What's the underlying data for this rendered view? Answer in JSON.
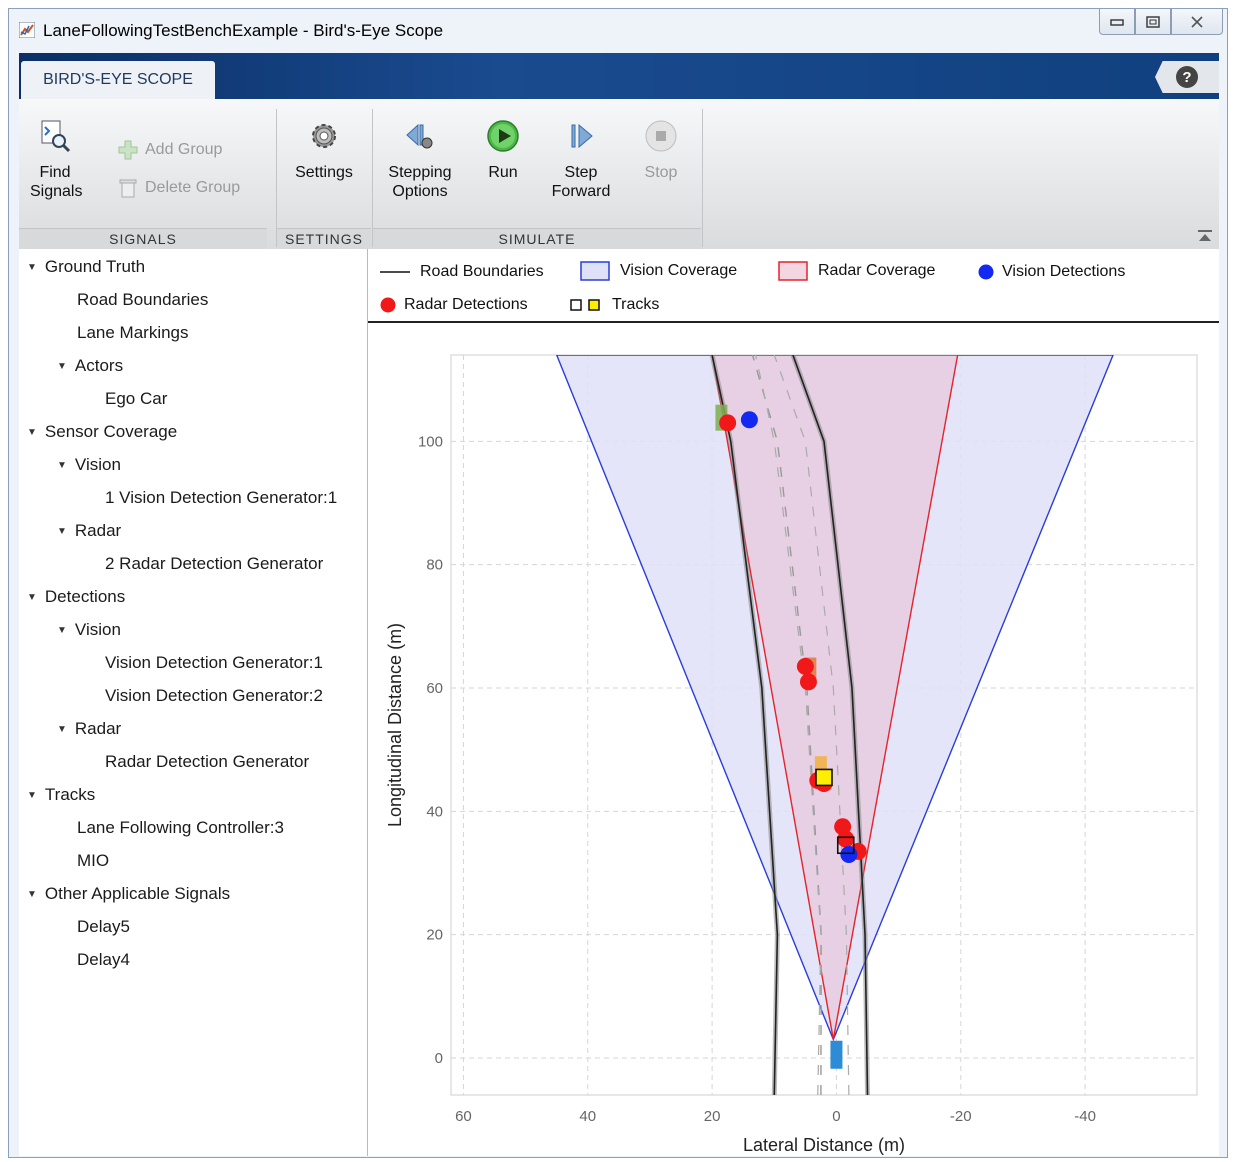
{
  "window": {
    "title": "LaneFollowingTestBenchExample - Bird's-Eye Scope"
  },
  "tab": {
    "label": "BIRD'S-EYE SCOPE"
  },
  "toolstrip": {
    "find_signals": "Find Signals",
    "add_group": "Add Group",
    "delete_group": "Delete Group",
    "settings": "Settings",
    "stepping_options": "Stepping Options",
    "run": "Run",
    "step_forward": "Step Forward",
    "stop": "Stop",
    "sections": {
      "signals": "SIGNALS",
      "settings": "SETTINGS",
      "simulate": "SIMULATE"
    }
  },
  "tree": {
    "ground_truth": "Ground Truth",
    "road_boundaries": "Road Boundaries",
    "lane_markings": "Lane Markings",
    "actors": "Actors",
    "ego_car": "Ego Car",
    "sensor_coverage": "Sensor Coverage",
    "vision": "Vision",
    "vision_gen_1": "1 Vision Detection Generator:1",
    "radar": "Radar",
    "radar_gen_2": "2 Radar Detection Generator",
    "detections": "Detections",
    "det_vision": "Vision",
    "vdg1": "Vision Detection Generator:1",
    "vdg2": "Vision Detection Generator:2",
    "det_radar": "Radar",
    "rdg": "Radar Detection Generator",
    "tracks": "Tracks",
    "lfc3": "Lane Following Controller:3",
    "mio": "MIO",
    "other": "Other Applicable Signals",
    "delay5": "Delay5",
    "delay4": "Delay4"
  },
  "legend": {
    "road_boundaries": "Road Boundaries",
    "vision_coverage": "Vision Coverage",
    "radar_coverage": "Radar Coverage",
    "vision_detections": "Vision Detections",
    "radar_detections": "Radar Detections",
    "tracks": "Tracks"
  },
  "colors": {
    "vision_fill": "#dfe1f8",
    "vision_line": "#2a3ddb",
    "radar_fill": "#e8cde0",
    "radar_line": "#e3242b",
    "vision_det": "#1328f0",
    "radar_det": "#f01818",
    "track_fill": "#ffee00",
    "ego": "#2e8bd6"
  },
  "chart_data": {
    "type": "scatter",
    "xlabel": "Lateral Distance (m)",
    "ylabel": "Longitudinal Distance (m)",
    "x_ticks": [
      60,
      40,
      20,
      0,
      -20,
      -40
    ],
    "y_ticks": [
      0,
      20,
      40,
      60,
      80,
      100
    ],
    "xlim": [
      -58,
      62
    ],
    "ylim": [
      -6,
      114
    ],
    "x_reversed": true,
    "grid": true,
    "vision_coverage": {
      "origin": [
        0.5,
        3
      ],
      "left_edge": [
        45,
        114
      ],
      "right_edge": [
        -44.5,
        114
      ]
    },
    "radar_coverage": {
      "origin": [
        0.5,
        3
      ],
      "left_edge": [
        20,
        114
      ],
      "right_edge": [
        -19.5,
        114
      ]
    },
    "road_boundaries": [
      [
        [
          10,
          -6
        ],
        [
          9.5,
          20
        ],
        [
          12,
          60
        ],
        [
          17,
          100
        ],
        [
          20,
          114
        ]
      ],
      [
        [
          -5,
          -6
        ],
        [
          -4.6,
          20
        ],
        [
          -2.5,
          60
        ],
        [
          2,
          100
        ],
        [
          7,
          114
        ]
      ]
    ],
    "vision_detections": [
      {
        "x": 14,
        "y": 103.5
      },
      {
        "x": -2,
        "y": 33
      }
    ],
    "radar_detections": [
      {
        "x": 17.5,
        "y": 103
      },
      {
        "x": 5,
        "y": 63.5
      },
      {
        "x": 4.5,
        "y": 61
      },
      {
        "x": 3,
        "y": 45
      },
      {
        "x": 2,
        "y": 44.5
      },
      {
        "x": -1,
        "y": 37.5
      },
      {
        "x": -1.5,
        "y": 35.5
      },
      {
        "x": -3.5,
        "y": 33.5
      }
    ],
    "tracks": [
      {
        "x": 2,
        "y": 45.5,
        "filled": true
      },
      {
        "x": -1.5,
        "y": 34.5,
        "filled": false
      }
    ],
    "ego_car": {
      "x": 0,
      "y": 1.5
    }
  }
}
